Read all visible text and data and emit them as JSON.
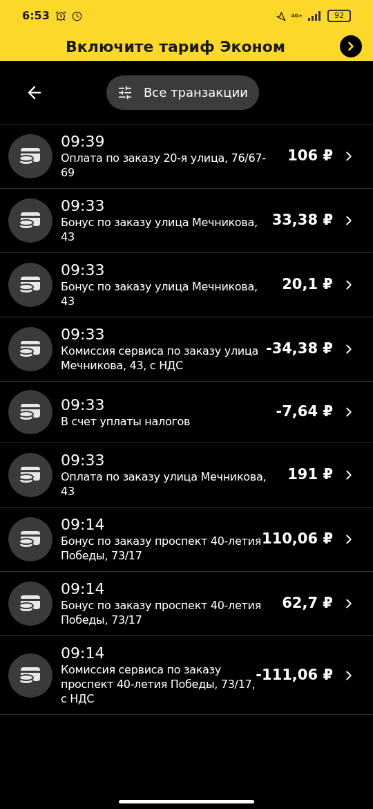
{
  "status_bar": {
    "time": "6:53",
    "network": "4G+",
    "battery": "92"
  },
  "banner": {
    "title": "Включите тариф Эконом"
  },
  "filter": {
    "label": "Все транзакции"
  },
  "transactions": [
    {
      "time": "09:39",
      "description": "Оплата по заказу 20-я улица, 76/67-69",
      "amount": "106 ₽"
    },
    {
      "time": "09:33",
      "description": "Бонус по заказу улица Мечникова, 43",
      "amount": "33,38 ₽"
    },
    {
      "time": "09:33",
      "description": "Бонус по заказу улица Мечникова, 43",
      "amount": "20,1 ₽"
    },
    {
      "time": "09:33",
      "description": "Комиссия сервиса по заказу улица Мечникова, 43, с НДС",
      "amount": "-34,38 ₽"
    },
    {
      "time": "09:33",
      "description": "В счет уплаты налогов",
      "amount": "-7,64 ₽"
    },
    {
      "time": "09:33",
      "description": "Оплата по заказу улица Мечникова, 43",
      "amount": "191 ₽"
    },
    {
      "time": "09:14",
      "description": "Бонус по заказу проспект 40-летия Победы, 73/17",
      "amount": "110,06 ₽"
    },
    {
      "time": "09:14",
      "description": "Бонус по заказу проспект 40-летия Победы, 73/17",
      "amount": "62,7 ₽"
    },
    {
      "time": "09:14",
      "description": "Комиссия сервиса по заказу проспект 40-летия Победы, 73/17, с НДС",
      "amount": "-111,06 ₽"
    }
  ]
}
